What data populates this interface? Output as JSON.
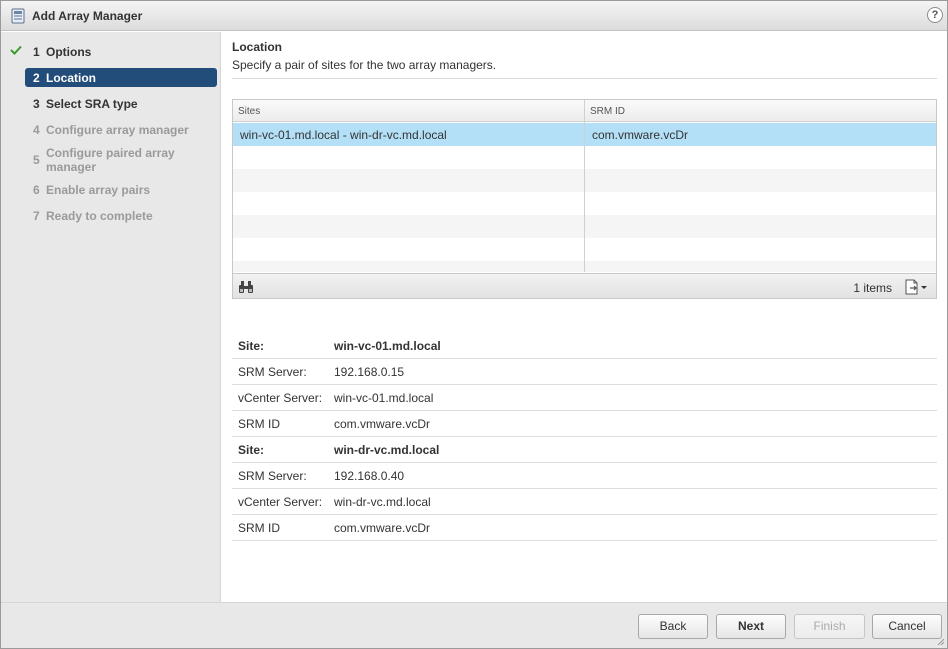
{
  "window": {
    "title": "Add Array Manager",
    "help": "?"
  },
  "steps": [
    {
      "num": "1",
      "label": "Options",
      "state": "done"
    },
    {
      "num": "2",
      "label": "Location",
      "state": "active"
    },
    {
      "num": "3",
      "label": "Select SRA type",
      "state": "pending"
    },
    {
      "num": "4",
      "label": "Configure array manager",
      "state": "disabled"
    },
    {
      "num": "5",
      "label": "Configure paired array manager",
      "state": "disabled"
    },
    {
      "num": "6",
      "label": "Enable array pairs",
      "state": "disabled"
    },
    {
      "num": "7",
      "label": "Ready to complete",
      "state": "disabled"
    }
  ],
  "page": {
    "title": "Location",
    "description": "Specify a pair of sites for the two array managers."
  },
  "grid": {
    "columns": [
      "Sites",
      "SRM ID"
    ],
    "rows": [
      {
        "sites": "win-vc-01.md.local - win-dr-vc.md.local",
        "srm_id": "com.vmware.vcDr",
        "selected": true
      }
    ],
    "item_count": "1 items"
  },
  "details": [
    {
      "key": "Site:",
      "value": "win-vc-01.md.local"
    },
    {
      "key": "SRM Server:",
      "value": "192.168.0.15"
    },
    {
      "key": "vCenter Server:",
      "value": "win-vc-01.md.local"
    },
    {
      "key": "SRM ID",
      "value": "com.vmware.vcDr"
    },
    {
      "key": "Site:",
      "value": "win-dr-vc.md.local"
    },
    {
      "key": "SRM Server:",
      "value": "192.168.0.40"
    },
    {
      "key": "vCenter Server:",
      "value": "win-dr-vc.md.local"
    },
    {
      "key": "SRM ID",
      "value": "com.vmware.vcDr"
    }
  ],
  "buttons": {
    "back": "Back",
    "next": "Next",
    "finish": "Finish",
    "cancel": "Cancel"
  },
  "colors": {
    "active_step": "#224d7a",
    "selected_row": "#b4e0f7",
    "check": "#3c9a2e"
  }
}
